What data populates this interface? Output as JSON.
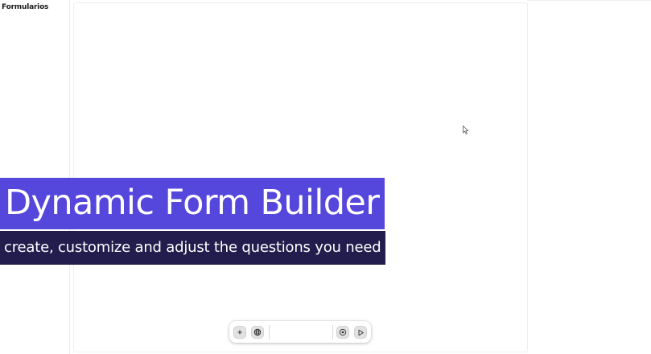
{
  "sidebar": {
    "title": "Formularios"
  },
  "overlay": {
    "title": "Dynamic Form Builder",
    "subtitle": "create, customize and adjust the questions you need"
  },
  "toolbar": {
    "buttons": [
      {
        "name": "add",
        "icon": "plus-icon"
      },
      {
        "name": "globe",
        "icon": "globe-icon"
      },
      {
        "name": "target",
        "icon": "target-icon"
      },
      {
        "name": "play",
        "icon": "play-icon"
      }
    ]
  },
  "colors": {
    "title_banner": "#5546dc",
    "subtitle_banner": "#221d4d"
  }
}
